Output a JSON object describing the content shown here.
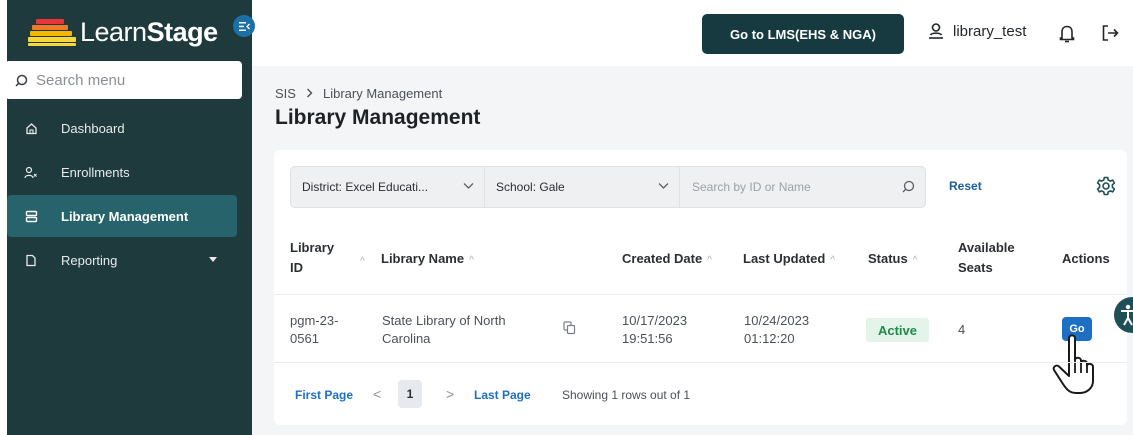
{
  "app": {
    "logo_light": "Learn",
    "logo_bold": "Stage"
  },
  "sidebar": {
    "search_placeholder": "Search menu",
    "items": [
      {
        "label": "Dashboard",
        "icon": "home-icon"
      },
      {
        "label": "Enrollments",
        "icon": "users-icon"
      },
      {
        "label": "Library Management",
        "icon": "database-icon",
        "active": true
      },
      {
        "label": "Reporting",
        "icon": "document-icon",
        "expandable": true
      }
    ]
  },
  "header": {
    "lms_button": "Go to LMS(EHS & NGA)",
    "username": "library_test"
  },
  "page": {
    "breadcrumb": [
      "SIS",
      "Library Management"
    ],
    "title": "Library Management"
  },
  "filters": {
    "district_label": "District:",
    "district_value": "Excel Educati...",
    "school_label": "School:",
    "school_value": "Gale",
    "search_placeholder": "Search by ID or Name",
    "reset": "Reset"
  },
  "table": {
    "columns": {
      "library_id_1": "Library",
      "library_id_2": "ID",
      "library_name": "Library Name",
      "created": "Created Date",
      "updated": "Last Updated",
      "status": "Status",
      "seats_1": "Available",
      "seats_2": "Seats",
      "actions": "Actions"
    },
    "rows": [
      {
        "id_1": "pgm-23-",
        "id_2": "0561",
        "name_1": "State Library of North",
        "name_2": "Carolina",
        "created_1": "10/17/2023",
        "created_2": "19:51:56",
        "updated_1": "10/24/2023",
        "updated_2": "01:12:20",
        "status": "Active",
        "seats": "4",
        "action": "Go"
      }
    ]
  },
  "pagination": {
    "first": "First Page",
    "prev": "<",
    "current": "1",
    "next": ">",
    "last": "Last Page",
    "summary": "Showing 1 rows out of 1"
  },
  "colors": {
    "sidebar_bg": "#1e3a3d",
    "active_item": "#26636a",
    "primary_button": "#163a40",
    "link": "#1d6fc4",
    "status_active": "#1e8a4c"
  }
}
